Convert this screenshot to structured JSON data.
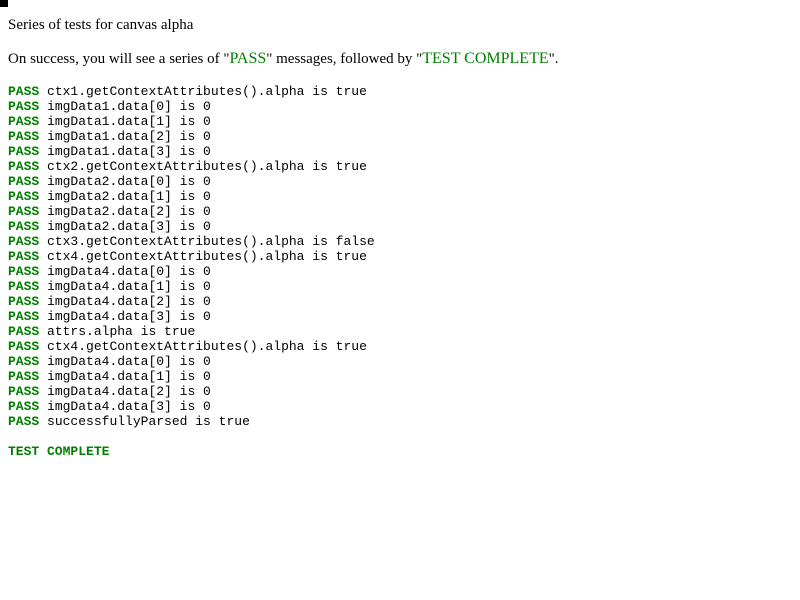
{
  "page": {
    "title": "Series of tests for canvas alpha",
    "intro": {
      "before_pass": "On success, you will see a series of \"",
      "pass_word": "PASS",
      "middle": "\" messages, followed by \"",
      "complete_word": "TEST COMPLETE",
      "after": "\"."
    }
  },
  "colors": {
    "pass": "#008000",
    "text": "#000000",
    "background": "#ffffff"
  },
  "results": [
    {
      "status": "PASS",
      "message": "ctx1.getContextAttributes().alpha is true"
    },
    {
      "status": "PASS",
      "message": "imgData1.data[0] is 0"
    },
    {
      "status": "PASS",
      "message": "imgData1.data[1] is 0"
    },
    {
      "status": "PASS",
      "message": "imgData1.data[2] is 0"
    },
    {
      "status": "PASS",
      "message": "imgData1.data[3] is 0"
    },
    {
      "status": "PASS",
      "message": "ctx2.getContextAttributes().alpha is true"
    },
    {
      "status": "PASS",
      "message": "imgData2.data[0] is 0"
    },
    {
      "status": "PASS",
      "message": "imgData2.data[1] is 0"
    },
    {
      "status": "PASS",
      "message": "imgData2.data[2] is 0"
    },
    {
      "status": "PASS",
      "message": "imgData2.data[3] is 0"
    },
    {
      "status": "PASS",
      "message": "ctx3.getContextAttributes().alpha is false"
    },
    {
      "status": "PASS",
      "message": "ctx4.getContextAttributes().alpha is true"
    },
    {
      "status": "PASS",
      "message": "imgData4.data[0] is 0"
    },
    {
      "status": "PASS",
      "message": "imgData4.data[1] is 0"
    },
    {
      "status": "PASS",
      "message": "imgData4.data[2] is 0"
    },
    {
      "status": "PASS",
      "message": "imgData4.data[3] is 0"
    },
    {
      "status": "PASS",
      "message": "attrs.alpha is true"
    },
    {
      "status": "PASS",
      "message": "ctx4.getContextAttributes().alpha is true"
    },
    {
      "status": "PASS",
      "message": "imgData4.data[0] is 0"
    },
    {
      "status": "PASS",
      "message": "imgData4.data[1] is 0"
    },
    {
      "status": "PASS",
      "message": "imgData4.data[2] is 0"
    },
    {
      "status": "PASS",
      "message": "imgData4.data[3] is 0"
    },
    {
      "status": "PASS",
      "message": "successfullyParsed is true"
    }
  ],
  "footer": {
    "complete_text": "TEST COMPLETE"
  }
}
